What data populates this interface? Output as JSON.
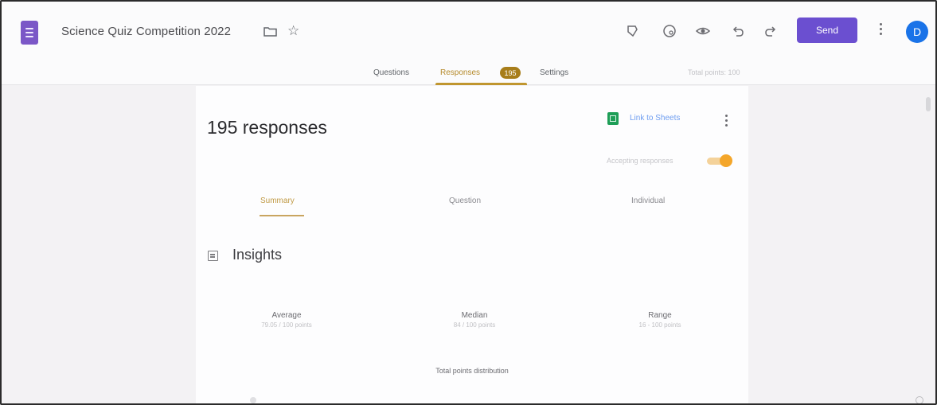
{
  "header": {
    "form_title": "Science Quiz Competition 2022",
    "send_label": "Send",
    "avatar_initial": "D",
    "accent_color": "#6b4fd0",
    "tools": [
      "customize-theme-icon",
      "palette-icon",
      "preview-icon",
      "undo-icon",
      "redo-icon"
    ]
  },
  "tabs": {
    "questions": "Questions",
    "responses": "Responses",
    "responses_count": "195",
    "settings": "Settings",
    "total_points": "Total points: 100"
  },
  "responses": {
    "count_label": "195 responses",
    "link_to_sheets": "Link to Sheets",
    "accepting_label": "Accepting responses",
    "accepting": true
  },
  "subtabs": {
    "summary": "Summary",
    "question": "Question",
    "individual": "Individual"
  },
  "insights": {
    "title": "Insights",
    "average": {
      "label": "Average",
      "value": "79.05 / 100 points"
    },
    "median": {
      "label": "Median",
      "value": "84 / 100 points"
    },
    "range": {
      "label": "Range",
      "value": "16 - 100 points"
    },
    "distribution_title": "Total points distribution"
  }
}
